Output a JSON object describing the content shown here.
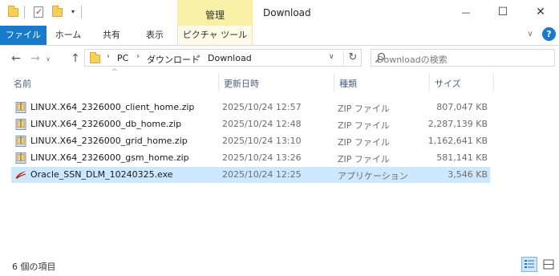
{
  "window": {
    "title": "Download",
    "contextual_tab_group": "管理",
    "minimize_glyph": "—",
    "maximize_glyph": "☐",
    "close_glyph": "✕"
  },
  "quick_access": {
    "dropdown_glyph": "▾",
    "icons": [
      "folder-icon",
      "properties-icon",
      "new-folder-icon"
    ]
  },
  "ribbon": {
    "file_tab": "ファイル",
    "tabs": [
      "ホーム",
      "共有",
      "表示"
    ],
    "contextual_tab": "ピクチャ ツール",
    "expand_glyph": "∨",
    "help_glyph": "?"
  },
  "navigation": {
    "back_glyph": "←",
    "forward_glyph": "→",
    "recent_glyph": "∨",
    "up_glyph": "↑",
    "breadcrumb": [
      "PC",
      "ダウンロード",
      "Download"
    ],
    "breadcrumb_separator": "›",
    "address_dropdown_glyph": "∨",
    "refresh_glyph": "↻"
  },
  "search": {
    "placeholder": "Downloadの検索"
  },
  "columns": {
    "name": "名前",
    "date": "更新日時",
    "type": "種類",
    "size": "サイズ"
  },
  "files": [
    {
      "name": "LINUX.X64_2326000_client_home.zip",
      "date": "2025/10/24 12:57",
      "type": "ZIP ファイル",
      "size": "807,047 KB",
      "icon": "zip-icon",
      "selected": false
    },
    {
      "name": "LINUX.X64_2326000_db_home.zip",
      "date": "2025/10/24 12:48",
      "type": "ZIP ファイル",
      "size": "2,287,139 KB",
      "icon": "zip-icon",
      "selected": false
    },
    {
      "name": "LINUX.X64_2326000_grid_home.zip",
      "date": "2025/10/24 13:10",
      "type": "ZIP ファイル",
      "size": "1,162,641 KB",
      "icon": "zip-icon",
      "selected": false
    },
    {
      "name": "LINUX.X64_2326000_gsm_home.zip",
      "date": "2025/10/24 13:26",
      "type": "ZIP ファイル",
      "size": "581,141 KB",
      "icon": "zip-icon",
      "selected": false
    },
    {
      "name": "Oracle_SSN_DLM_10240325.exe",
      "date": "2025/10/24 12:25",
      "type": "アプリケーション",
      "size": "3,546 KB",
      "icon": "oracle-exe-icon",
      "selected": true
    }
  ],
  "status_bar": {
    "item_count": "6 個の項目"
  },
  "colors": {
    "file_tab": "#1979ca",
    "contextual_tab": "#f7f0a6",
    "selection": "#cce8ff",
    "header_text": "#4c607a"
  }
}
